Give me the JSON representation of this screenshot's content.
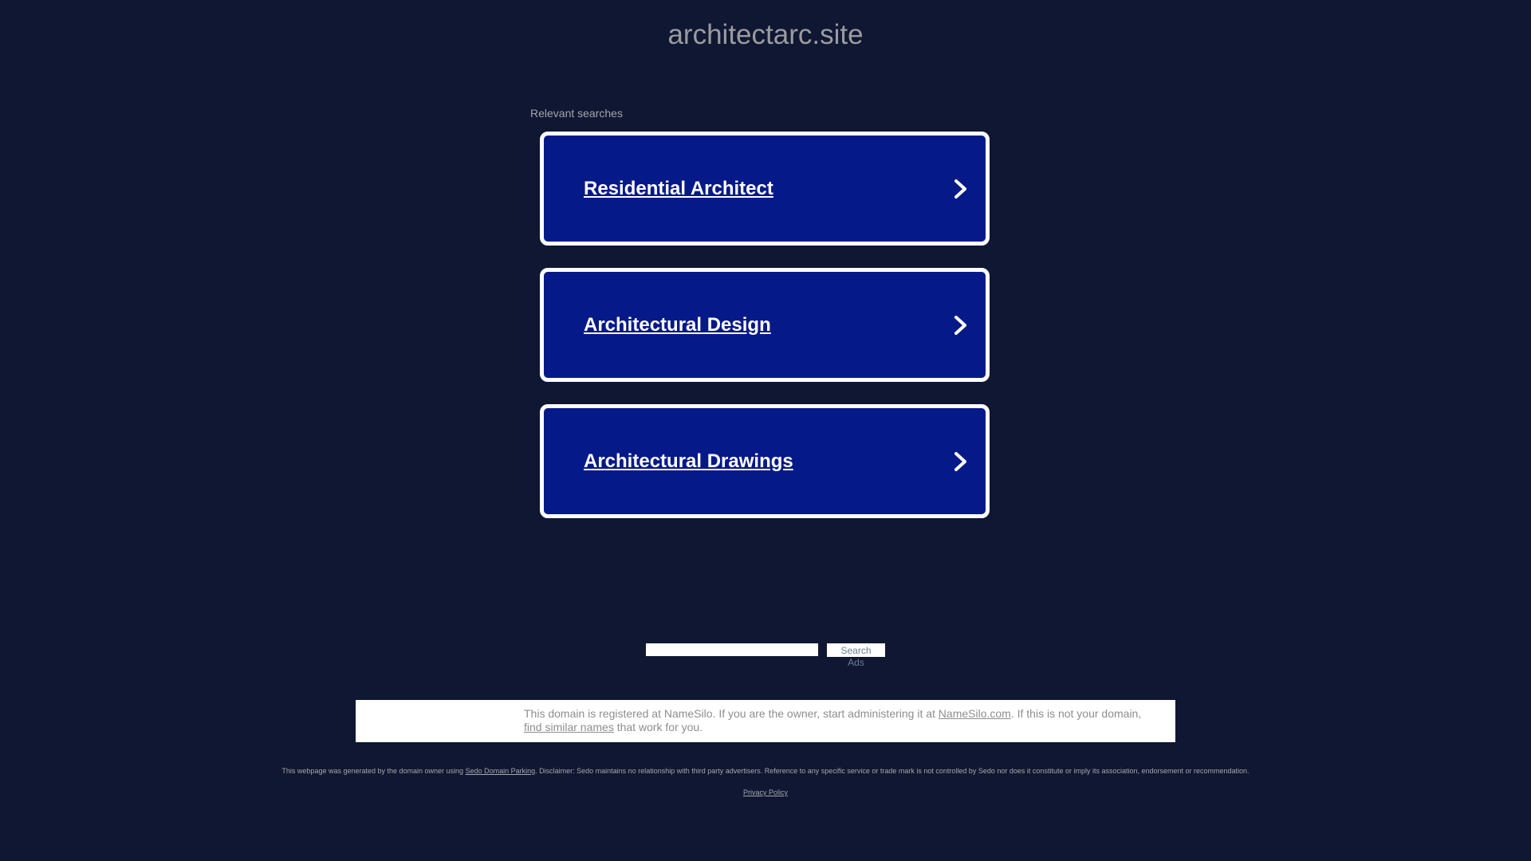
{
  "header": {
    "domain": "architectarc.site"
  },
  "relevant_searches": {
    "label": "Relevant searches",
    "items": [
      {
        "label": "Residential Architect",
        "icon": "chevron-right-icon"
      },
      {
        "label": "Architectural Design",
        "icon": "chevron-right-icon"
      },
      {
        "label": "Architectural Drawings",
        "icon": "chevron-right-icon"
      }
    ]
  },
  "search_ads": {
    "input_value": "",
    "button_label": "Search Ads"
  },
  "registry": {
    "text_1": "This domain is registered at NameSilo. If you are the owner, start administering it at ",
    "namesilo_link": "NameSilo.com",
    "text_2": ". If this is not your domain, ",
    "similar_link": "find similar names",
    "text_3": " that work for you."
  },
  "footer": {
    "disclaimer_1": "This webpage was generated by the domain owner using ",
    "sedo_link": "Sedo Domain Parking",
    "disclaimer_2": ". Disclaimer: Sedo maintains no relationship with third party advertisers. Reference to any specific service or trade mark is not controlled by Sedo nor does it constitute or imply its association, endorsement or recommendation.",
    "privacy_policy": "Privacy Policy"
  },
  "colors": {
    "background": "#0f1732",
    "card_background": "#061989",
    "card_border": "#ffffff",
    "title_text": "#9b9ba0"
  }
}
